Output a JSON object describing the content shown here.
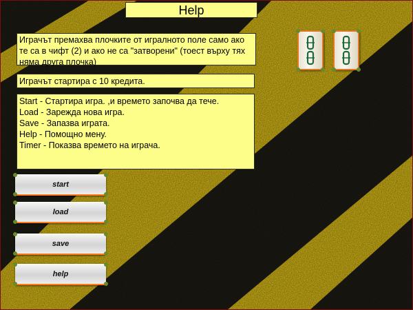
{
  "title": "Help",
  "help": {
    "rule_text": "Играчът премахва плочките от игралното поле само ако те са в чифт (2) и ако не са \"затворени\" (тоест върху тях няма друга плочка)",
    "credits_text": "Играчът стартира с 10 кредита.",
    "commands": [
      "Start - Стартира игра. ,и времето започва да тече.",
      "Load - Зарежда нова игра.",
      "Save - Запазва играта.",
      "Help - Помощно мену.",
      "Timer - Показва времето на играча."
    ]
  },
  "buttons": {
    "start": "start",
    "load": "load",
    "save": "save",
    "help": "help"
  },
  "tiles": [
    {
      "icon": "bamboo-tile-icon"
    },
    {
      "icon": "bamboo-tile-icon"
    }
  ],
  "colors": {
    "panel": "#fdfd8a",
    "stripe_yellow": "#e0c21a",
    "stripe_dark": "#1e1c14",
    "button_accent": "#ff7a1a",
    "tile_border": "#e07a20"
  }
}
